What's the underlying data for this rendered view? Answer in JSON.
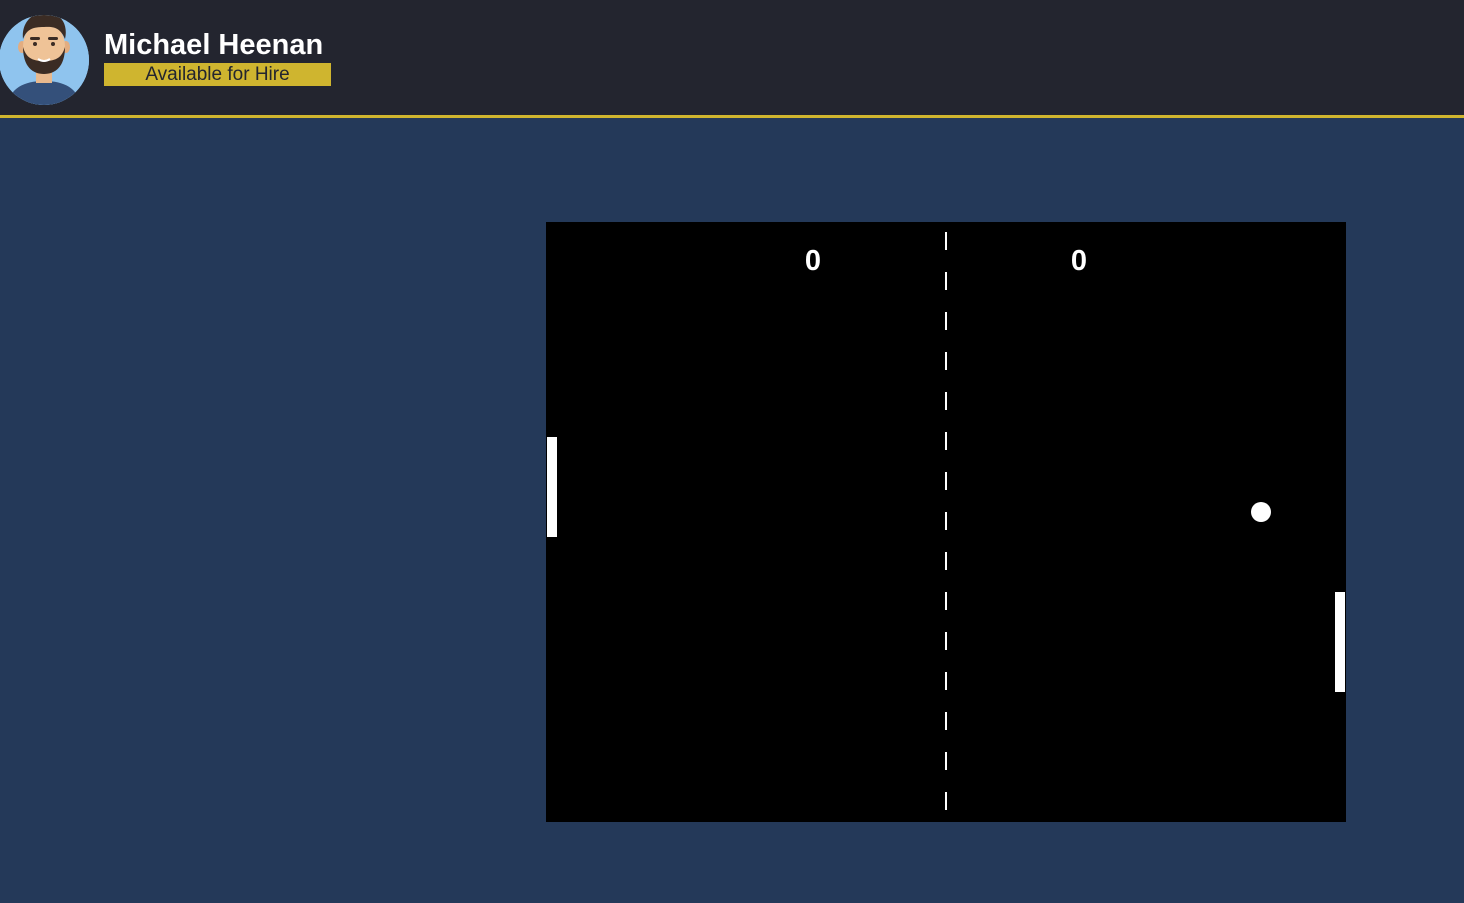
{
  "header": {
    "name": "Michael Heenan",
    "status_badge": "Available for Hire",
    "avatar_icon": "bearded-man-avatar-icon"
  },
  "game": {
    "score_left": "0",
    "score_right": "0"
  },
  "colors": {
    "header_bg": "#23252f",
    "accent": "#cfb52f",
    "page_bg": "#243959",
    "game_bg": "#000000",
    "game_fg": "#ffffff"
  }
}
